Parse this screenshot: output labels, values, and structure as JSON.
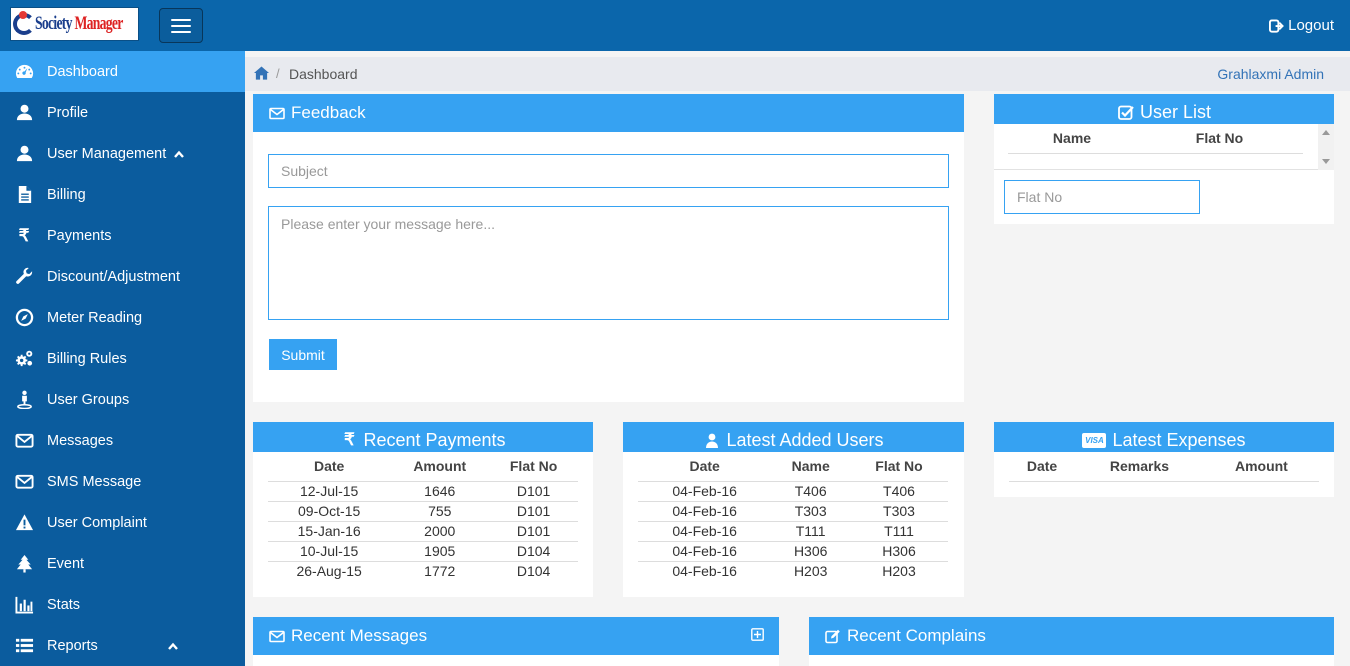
{
  "header": {
    "logo_text_1": "Society",
    "logo_text_2": "Manager",
    "logout_label": "Logout"
  },
  "sidebar": {
    "items": [
      {
        "label": "Dashboard",
        "icon": "dashboard-icon"
      },
      {
        "label": "Profile",
        "icon": "user-icon"
      },
      {
        "label": "User Management",
        "icon": "user-icon"
      },
      {
        "label": "Billing",
        "icon": "file-icon"
      },
      {
        "label": "Payments",
        "icon": "rupee-icon"
      },
      {
        "label": "Discount/Adjustment",
        "icon": "wrench-icon"
      },
      {
        "label": "Meter Reading",
        "icon": "compass-icon"
      },
      {
        "label": "Billing Rules",
        "icon": "gears-icon"
      },
      {
        "label": "User Groups",
        "icon": "street-view-icon"
      },
      {
        "label": "Messages",
        "icon": "envelope-icon"
      },
      {
        "label": "SMS Message",
        "icon": "envelope-icon"
      },
      {
        "label": "User Complaint",
        "icon": "warning-icon"
      },
      {
        "label": "Event",
        "icon": "tree-icon"
      },
      {
        "label": "Stats",
        "icon": "bar-chart-icon"
      },
      {
        "label": "Reports",
        "icon": "list-icon"
      }
    ]
  },
  "breadcrumb": {
    "current": "Dashboard",
    "user": "Grahlaxmi Admin"
  },
  "feedback": {
    "title": "Feedback",
    "subject_placeholder": "Subject",
    "message_placeholder": "Please enter your message here...",
    "submit_label": "Submit"
  },
  "user_list": {
    "title": "User List",
    "columns": [
      "Name",
      "Flat No"
    ],
    "search_placeholder": "Flat No"
  },
  "recent_payments": {
    "title": "Recent Payments",
    "columns": [
      "Date",
      "Amount",
      "Flat No"
    ],
    "rows": [
      [
        "12-Jul-15",
        "1646",
        "D101"
      ],
      [
        "09-Oct-15",
        "755",
        "D101"
      ],
      [
        "15-Jan-16",
        "2000",
        "D101"
      ],
      [
        "10-Jul-15",
        "1905",
        "D104"
      ],
      [
        "26-Aug-15",
        "1772",
        "D104"
      ]
    ]
  },
  "latest_users": {
    "title": "Latest Added Users",
    "columns": [
      "Date",
      "Name",
      "Flat No"
    ],
    "rows": [
      [
        "04-Feb-16",
        "T406",
        "T406"
      ],
      [
        "04-Feb-16",
        "T303",
        "T303"
      ],
      [
        "04-Feb-16",
        "T111",
        "T111"
      ],
      [
        "04-Feb-16",
        "H306",
        "H306"
      ],
      [
        "04-Feb-16",
        "H203",
        "H203"
      ]
    ]
  },
  "latest_expenses": {
    "title": "Latest Expenses",
    "columns": [
      "Date",
      "Remarks",
      "Amount"
    ],
    "rows": []
  },
  "recent_messages": {
    "title": "Recent Messages"
  },
  "recent_complains": {
    "title": "Recent Complains"
  },
  "colors": {
    "topbar": "#0b66ab",
    "sidebar": "#0b5c9e",
    "accent": "#36a2f2"
  }
}
